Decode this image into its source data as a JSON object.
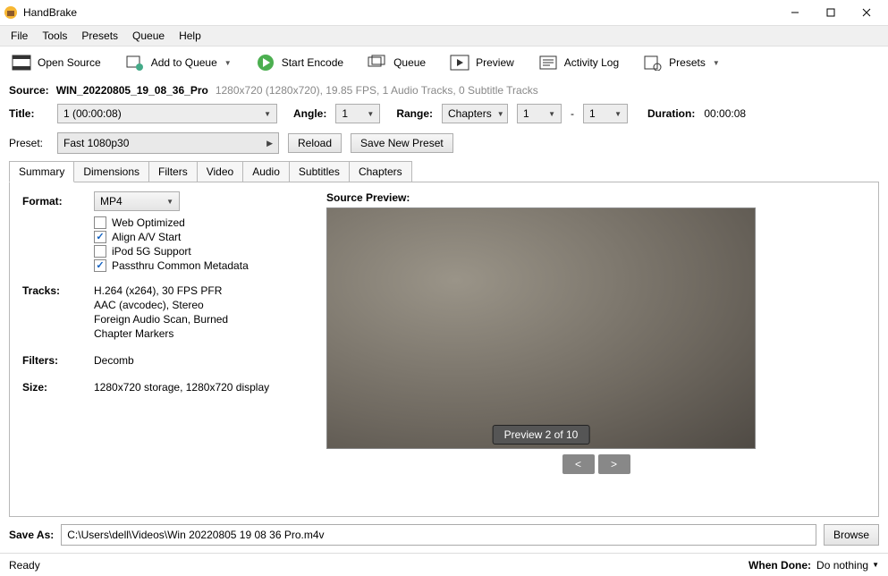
{
  "window": {
    "title": "HandBrake"
  },
  "menu": {
    "file": "File",
    "tools": "Tools",
    "presets": "Presets",
    "queue": "Queue",
    "help": "Help"
  },
  "toolbar": {
    "open_source": "Open Source",
    "add_to_queue": "Add to Queue",
    "start_encode": "Start Encode",
    "queue": "Queue",
    "preview": "Preview",
    "activity_log": "Activity Log",
    "presets": "Presets"
  },
  "source": {
    "label": "Source:",
    "name": "WIN_20220805_19_08_36_Pro",
    "meta": "1280x720 (1280x720), 19.85 FPS, 1 Audio Tracks, 0 Subtitle Tracks"
  },
  "title_row": {
    "title_label": "Title:",
    "title_value": "1  (00:00:08)",
    "angle_label": "Angle:",
    "angle_value": "1",
    "range_label": "Range:",
    "range_type": "Chapters",
    "range_from": "1",
    "range_sep": "-",
    "range_to": "1",
    "duration_label": "Duration:",
    "duration_value": "00:00:08"
  },
  "preset_row": {
    "label": "Preset:",
    "value": "Fast 1080p30",
    "reload": "Reload",
    "save_new": "Save New Preset"
  },
  "tabs": {
    "summary": "Summary",
    "dimensions": "Dimensions",
    "filters": "Filters",
    "video": "Video",
    "audio": "Audio",
    "subtitles": "Subtitles",
    "chapters": "Chapters"
  },
  "summary": {
    "format_label": "Format:",
    "format_value": "MP4",
    "web_optimized": "Web Optimized",
    "align_av": "Align A/V Start",
    "ipod": "iPod 5G Support",
    "passthru": "Passthru Common Metadata",
    "tracks_label": "Tracks:",
    "tracks": [
      "H.264 (x264), 30 FPS PFR",
      "AAC (avcodec), Stereo",
      "Foreign Audio Scan, Burned",
      "Chapter Markers"
    ],
    "filters_label": "Filters:",
    "filters_value": "Decomb",
    "size_label": "Size:",
    "size_value": "1280x720 storage, 1280x720 display",
    "preview_label": "Source Preview:",
    "preview_badge": "Preview 2 of 10",
    "prev": "<",
    "next": ">"
  },
  "save": {
    "label": "Save As:",
    "path": "C:\\Users\\dell\\Videos\\Win 20220805 19 08 36 Pro.m4v",
    "browse": "Browse"
  },
  "status": {
    "text": "Ready",
    "when_done_label": "When Done:",
    "when_done_value": "Do nothing"
  }
}
